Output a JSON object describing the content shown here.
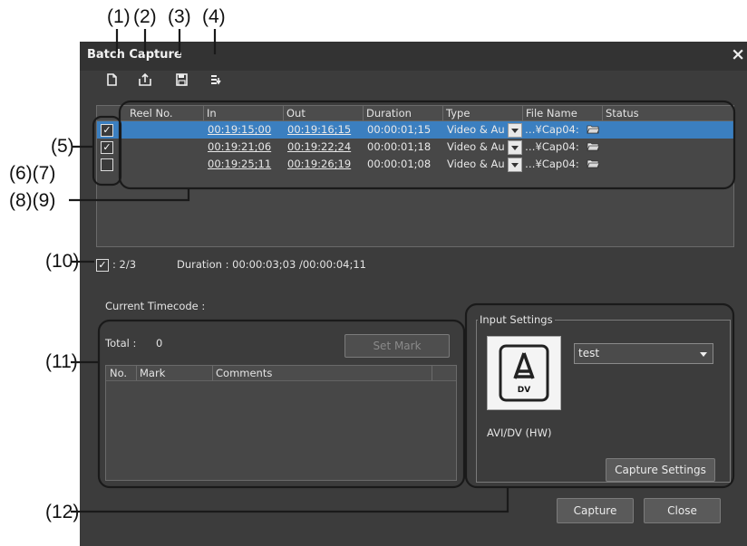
{
  "callouts": {
    "c1": "(1)",
    "c2": "(2)",
    "c3": "(3)",
    "c4": "(4)",
    "c5": "(5)",
    "c67": "(6)(7)",
    "c89": "(8)(9)",
    "c10": "(10)",
    "c11": "(11)",
    "c12": "(12)"
  },
  "window": {
    "title": "Batch Capture",
    "close_glyph": "×"
  },
  "toolbar": {
    "new_icon": "new-document-icon",
    "export_icon": "export-icon",
    "save_icon": "save-icon",
    "import_icon": "list-import-icon"
  },
  "table": {
    "headers": {
      "reel": "Reel No.",
      "in": "In",
      "out": "Out",
      "duration": "Duration",
      "type": "Type",
      "file": "File Name",
      "status": "Status"
    },
    "rows": [
      {
        "checked": true,
        "reel": "",
        "in": "00:19:15;00",
        "out": "00:19:16;15",
        "duration": "00:00:01;15",
        "type": "Video & Au",
        "file": "…¥Cap04:",
        "status": "",
        "selected": true
      },
      {
        "checked": true,
        "reel": "",
        "in": "00:19:21;06",
        "out": "00:19:22;24",
        "duration": "00:00:01;18",
        "type": "Video & Au",
        "file": "…¥Cap04:",
        "status": "",
        "selected": false
      },
      {
        "checked": false,
        "reel": "",
        "in": "00:19:25;11",
        "out": "00:19:26;19",
        "duration": "00:00:01;08",
        "type": "Video & Au",
        "file": "…¥Cap04:",
        "status": "",
        "selected": false
      }
    ]
  },
  "summary": {
    "checked_count": ": 2/3",
    "duration": "Duration : 00:00:03;03 /00:00:04;11"
  },
  "timecode": {
    "label": "Current Timecode :"
  },
  "marks": {
    "total_label": "Total :",
    "total_value": "0",
    "set_mark_label": "Set Mark",
    "headers": {
      "no": "No.",
      "mark": "Mark",
      "comments": "Comments"
    }
  },
  "input_settings": {
    "legend": "Input Settings",
    "preset": "test",
    "device_name": "AVI/DV (HW)",
    "icon_text": "DV",
    "capture_settings_label": "Capture Settings"
  },
  "footer": {
    "capture_label": "Capture",
    "close_label": "Close"
  },
  "colors": {
    "window_bg": "#3c3c3c",
    "selection": "#3b7fc0",
    "callout_box": "#1a1a1a"
  }
}
